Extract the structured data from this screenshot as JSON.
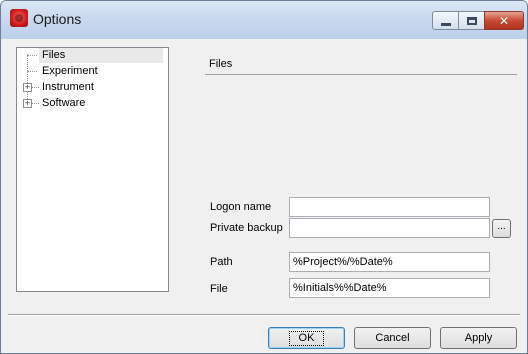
{
  "window": {
    "title": "Options"
  },
  "tree": {
    "items": [
      {
        "label": "Files",
        "expandable": false,
        "selected": true
      },
      {
        "label": "Experiment",
        "expandable": false,
        "selected": false
      },
      {
        "label": "Instrument",
        "expandable": true,
        "selected": false
      },
      {
        "label": "Software",
        "expandable": true,
        "selected": false
      }
    ]
  },
  "panel": {
    "title": "Files",
    "fields": {
      "logon_name": {
        "label": "Logon name",
        "value": ""
      },
      "private_backup": {
        "label": "Private backup",
        "value": "",
        "browse_label": "..."
      },
      "path": {
        "label": "Path",
        "value": "%Project%/%Date%"
      },
      "file": {
        "label": "File",
        "value": "%Initials%%Date%"
      }
    }
  },
  "buttons": {
    "ok": "OK",
    "cancel": "Cancel",
    "apply": "Apply"
  },
  "icons": {
    "app": "application-logo-icon",
    "expander": "plus-expander-icon"
  },
  "colors": {
    "titlebar": "#c9d9ee",
    "close_button": "#c74a35",
    "dialog_background": "#f0f0f0"
  }
}
